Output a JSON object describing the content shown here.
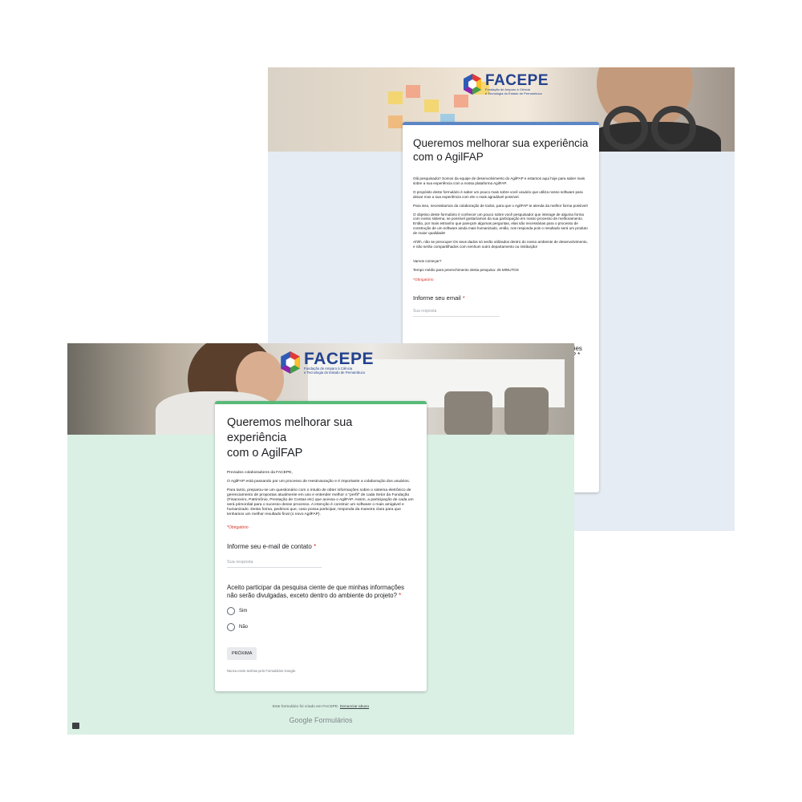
{
  "back_form": {
    "logo": {
      "name": "FACEPE",
      "subtitle_1": "Fundação de Amparo à Ciência",
      "subtitle_2": "e Tecnologia do Estado de Pernambuco"
    },
    "title_line1": "Queremos melhorar sua experiência",
    "title_line2": "com o AgilFAP",
    "description": [
      "Olá pesquisador! Somos da equipe de desenvolvimento do AgilFAP e estamos aqui hoje para saber mais sobre a sua experiência com a nossa plataforma AgilFAP.",
      "O propósito deste formulário é saber um pouco mais sobre você usuário que utiliza nosso software para deixar mos a sua experiência com ele o mais agradável possível.",
      "Para isso, necessitamos da colaboração de todos, para que o AgilFAP te atenda da melhor forma possível!",
      "O objetivo deste formulário é conhecer um pouco sobre você pesquisador que interage de alguma forma com nosso sistema, se possível gostaríamos da sua participação em nosso processo de melhoramento. Então, por mais estranho que pareçam algumas perguntas, elas são necessárias para o processo de construção de um software ainda mais humanizado, então, nos responda pois o resultado será um produto de maior qualidade!",
      "Ahhh, não se preocupe! Os seus dados só serão utilizados dentro do nosso ambiente de desenvolvimento, e não serão compartilhados com nenhum outro departamento ou instituição!",
      "Vamos começar?",
      "Tempo médio para preenchimento desta pesquisa: 25 MINUTOS"
    ],
    "required_note": "*Obrigatório",
    "question1": {
      "label": "Informe seu email",
      "star": "*",
      "placeholder": "Sua resposta"
    },
    "peek_text_1": "ções",
    "peek_text_2": "o? *"
  },
  "front_form": {
    "logo": {
      "name": "FACEPE",
      "subtitle_1": "Fundação de Amparo à Ciência",
      "subtitle_2": "e Tecnologia do Estado de Pernambuco"
    },
    "title_line1": "Queremos melhorar sua experiência",
    "title_line2": "com o AgilFAP",
    "description": [
      "Prezados colaboradores da FACEPE,",
      "O AgilFAP está passando por um processo de reestruturação e é importante a colaboração dos usuários.",
      "Para tanto, preparou-se um questionário com o intuito de obter informações sobre o sistema eletrônico de gerenciamento de propostas atualmente em uso e entender melhor o \"perfil\" de cada Setor da Fundação (Financeiro, Patrimônio, Prestação de Contas etc) que acessa o AgilFAP. Assim, a participação de cada um será primordial para o sucesso desse processo. A intenção é construir um software o mais amigável e humanizado. Desta forma, pedimos que, caso possa participar, responda da maneira clara para que tenhamos um melhor resultado final (o novo AgilFAP)."
    ],
    "required_note": "*Obrigatório",
    "question1": {
      "label": "Informe seu e-mail de contato",
      "star": "*",
      "placeholder": "Sua resposta"
    },
    "question2": {
      "label": "Aceito participar da pesquisa ciente de que minhas informações não serão divulgadas, exceto dentro do ambiente do projeto?",
      "star": "*",
      "options": [
        "Sim",
        "Não"
      ]
    },
    "next_button": "PRÓXIMA",
    "never_submit": "Nunca envie senhas pelo Formulários Google.",
    "footer": {
      "text": "Este formulário foi criado em FACEPE.",
      "link": "Denunciar abuso"
    },
    "google_brand": {
      "google": "Google",
      "forms": "Formulários"
    }
  },
  "colors": {
    "back_accent": "#5b86c5",
    "front_accent": "#57bb78",
    "back_bg": "#e6ecf4",
    "front_bg": "#daf0e4",
    "required": "#d93025",
    "logo_blue": "#23428f"
  }
}
